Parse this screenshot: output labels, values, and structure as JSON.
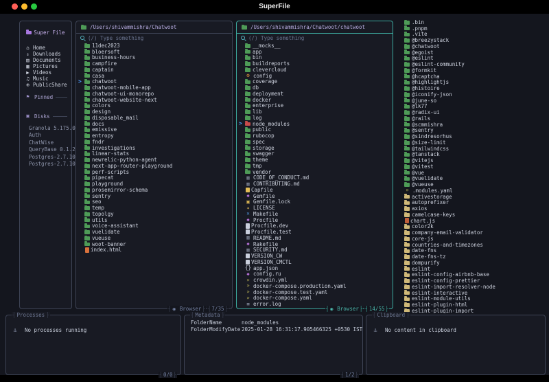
{
  "window": {
    "title": "SuperFile"
  },
  "colors": {
    "bg_app": "#14161e",
    "bg_panel": "#181a23",
    "accent": "#3caa9f",
    "border": "#3e4456",
    "cursor_blue": "#4d9fff",
    "folder_green": "#4e9b57",
    "npm_red": "#c84b4b",
    "pkg_tan": "#cfb878",
    "path": "#b6abdf"
  },
  "sidebar": {
    "title": "Super File",
    "title_icon": "folder-app",
    "items": [
      {
        "icon": "home",
        "label": "Home"
      },
      {
        "icon": "downloads",
        "label": "Downloads"
      },
      {
        "icon": "documents",
        "label": "Documents"
      },
      {
        "icon": "pictures",
        "label": "Pictures"
      },
      {
        "icon": "videos",
        "label": "Videos"
      },
      {
        "icon": "music",
        "label": "Music"
      },
      {
        "icon": "publicshare",
        "label": "PublicShare"
      }
    ],
    "sections": [
      {
        "label": "Pinned",
        "icon": "pin",
        "items": []
      },
      {
        "label": "Disks",
        "icon": "disk",
        "items": [
          "Granola 5.175.0...",
          "Auth",
          "ChatWise",
          "QueryBase 0.1.2...",
          "Postgres-2.7.10...",
          "Postgres-2.7.10..."
        ]
      }
    ]
  },
  "panels": [
    {
      "path": "/Users/shivammishra/Chatwoot",
      "search_placeholder": "(/) Type something",
      "mode_label": "Browser",
      "counter": "7/35",
      "active": false,
      "files": [
        {
          "icon": "folder",
          "label": "11dec2023"
        },
        {
          "icon": "folder",
          "label": "bloersoft"
        },
        {
          "icon": "folder",
          "label": "business-hours"
        },
        {
          "icon": "folder",
          "label": "campfire"
        },
        {
          "icon": "folder",
          "label": "captain"
        },
        {
          "icon": "folder",
          "label": "casa"
        },
        {
          "icon": "folder",
          "label": "chatwoot",
          "selected": true
        },
        {
          "icon": "folder",
          "label": "chatwoot-mobile-app"
        },
        {
          "icon": "folder",
          "label": "chatwoot-ui-monorepo"
        },
        {
          "icon": "folder",
          "label": "chatwoot-website-next"
        },
        {
          "icon": "folder",
          "label": "colors"
        },
        {
          "icon": "folder",
          "label": "design"
        },
        {
          "icon": "folder",
          "label": "disposable_mail"
        },
        {
          "icon": "folder",
          "label": "docs"
        },
        {
          "icon": "folder",
          "label": "emissive"
        },
        {
          "icon": "folder",
          "label": "entropy"
        },
        {
          "icon": "folder",
          "label": "fndr"
        },
        {
          "icon": "folder",
          "label": "investigations"
        },
        {
          "icon": "folder",
          "label": "linear-stats"
        },
        {
          "icon": "folder",
          "label": "newrelic-python-agent"
        },
        {
          "icon": "folder",
          "label": "next-app-router-playground"
        },
        {
          "icon": "folder",
          "label": "perf-scripts"
        },
        {
          "icon": "folder",
          "label": "pipecat"
        },
        {
          "icon": "folder",
          "label": "playground"
        },
        {
          "icon": "folder",
          "label": "prosemirror-schema"
        },
        {
          "icon": "folder",
          "label": "sentry"
        },
        {
          "icon": "folder",
          "label": "seo"
        },
        {
          "icon": "folder",
          "label": "temp"
        },
        {
          "icon": "folder",
          "label": "topolgy"
        },
        {
          "icon": "folder",
          "label": "utils"
        },
        {
          "icon": "folder",
          "label": "voice-assistant"
        },
        {
          "icon": "folder",
          "label": "vuelidate"
        },
        {
          "icon": "folder",
          "label": "vueuse"
        },
        {
          "icon": "folder",
          "label": "woot-banner"
        },
        {
          "icon": "html",
          "label": "index.html"
        }
      ]
    },
    {
      "path": "/Users/shivammishra/Chatwoot/chatwoot",
      "search_placeholder": "(/) Type something",
      "mode_label": "Browser",
      "counter": "14/55",
      "active": true,
      "files": [
        {
          "icon": "folder",
          "label": "__mocks__"
        },
        {
          "icon": "folder",
          "label": "app"
        },
        {
          "icon": "folder",
          "label": "bin"
        },
        {
          "icon": "folder",
          "label": "buildreports"
        },
        {
          "icon": "folder",
          "label": "clevercloud"
        },
        {
          "icon": "gear",
          "label": "config"
        },
        {
          "icon": "folder",
          "label": "coverage"
        },
        {
          "icon": "folder",
          "label": "db"
        },
        {
          "icon": "folder",
          "label": "deployment"
        },
        {
          "icon": "folder",
          "label": "docker"
        },
        {
          "icon": "folder",
          "label": "enterprise"
        },
        {
          "icon": "folder",
          "label": "lib"
        },
        {
          "icon": "folder",
          "label": "log"
        },
        {
          "icon": "folder-npm",
          "label": "node_modules",
          "selected": true
        },
        {
          "icon": "folder",
          "label": "public"
        },
        {
          "icon": "folder",
          "label": "rubocop"
        },
        {
          "icon": "folder",
          "label": "spec"
        },
        {
          "icon": "folder",
          "label": "storage"
        },
        {
          "icon": "folder",
          "label": "swagger"
        },
        {
          "icon": "folder",
          "label": "theme"
        },
        {
          "icon": "folder",
          "label": "tmp"
        },
        {
          "icon": "folder",
          "label": "vendor"
        },
        {
          "icon": "markdown",
          "label": "CODE_OF_CONDUCT.md"
        },
        {
          "icon": "markdown",
          "label": "CONTRIBUTING.md"
        },
        {
          "icon": "file-yellow",
          "label": "Capfile"
        },
        {
          "icon": "gem",
          "label": "Gemfile"
        },
        {
          "icon": "lock",
          "label": "Gemfile.lock"
        },
        {
          "icon": "key",
          "label": "LICENSE"
        },
        {
          "icon": "makefile",
          "label": "Makefile"
        },
        {
          "icon": "gem",
          "label": "Procfile"
        },
        {
          "icon": "file",
          "label": "Procfile.dev"
        },
        {
          "icon": "file",
          "label": "Procfile.test"
        },
        {
          "icon": "markdown",
          "label": "README.md"
        },
        {
          "icon": "gem",
          "label": "Rakefile"
        },
        {
          "icon": "markdown",
          "label": "SECURITY.md"
        },
        {
          "icon": "file",
          "label": "VERSION_CW"
        },
        {
          "icon": "file",
          "label": "VERSION_CMCTL"
        },
        {
          "icon": "json",
          "label": "app.json"
        },
        {
          "icon": "gem",
          "label": "config.ru"
        },
        {
          "icon": "yaml",
          "label": "crowdin.yml"
        },
        {
          "icon": "yaml",
          "label": "docker-compose.production.yaml"
        },
        {
          "icon": "yaml",
          "label": "docker-compose.test.yaml"
        },
        {
          "icon": "yaml",
          "label": "docker-compose.yaml"
        },
        {
          "icon": "log",
          "label": "error.log"
        }
      ]
    }
  ],
  "preview": {
    "files": [
      {
        "icon": "folder",
        "label": ".bin"
      },
      {
        "icon": "folder",
        "label": ".pnpm"
      },
      {
        "icon": "folder",
        "label": ".vite"
      },
      {
        "icon": "folder",
        "label": "@breezystack"
      },
      {
        "icon": "folder",
        "label": "@chatwoot"
      },
      {
        "icon": "folder",
        "label": "@egoist"
      },
      {
        "icon": "folder",
        "label": "@eslint"
      },
      {
        "icon": "folder",
        "label": "@eslint-community"
      },
      {
        "icon": "folder",
        "label": "@formkit"
      },
      {
        "icon": "folder",
        "label": "@hcaptcha"
      },
      {
        "icon": "folder",
        "label": "@highlightjs"
      },
      {
        "icon": "folder",
        "label": "@histoire"
      },
      {
        "icon": "folder",
        "label": "@iconify-json"
      },
      {
        "icon": "folder",
        "label": "@june-so"
      },
      {
        "icon": "folder",
        "label": "@lk77"
      },
      {
        "icon": "folder",
        "label": "@radix-ui"
      },
      {
        "icon": "folder",
        "label": "@rails"
      },
      {
        "icon": "folder",
        "label": "@scmmishra"
      },
      {
        "icon": "folder",
        "label": "@sentry"
      },
      {
        "icon": "folder",
        "label": "@sindresorhus"
      },
      {
        "icon": "folder",
        "label": "@size-limit"
      },
      {
        "icon": "folder",
        "label": "@tailwindcss"
      },
      {
        "icon": "folder",
        "label": "@tanstack"
      },
      {
        "icon": "folder",
        "label": "@vitejs"
      },
      {
        "icon": "folder",
        "label": "@vitest"
      },
      {
        "icon": "folder",
        "label": "@vue"
      },
      {
        "icon": "folder",
        "label": "@vuelidate"
      },
      {
        "icon": "folder",
        "label": "@vueuse"
      },
      {
        "icon": "yaml",
        "label": ".modules.yaml"
      },
      {
        "icon": "folder-package",
        "label": "activestorage"
      },
      {
        "icon": "folder-package",
        "label": "autoprefixer"
      },
      {
        "icon": "folder-package",
        "label": "axios"
      },
      {
        "icon": "folder-package",
        "label": "camelcase-keys"
      },
      {
        "icon": "chart",
        "label": "chart.js"
      },
      {
        "icon": "folder-package",
        "label": "color2k"
      },
      {
        "icon": "folder-package",
        "label": "company-email-validator"
      },
      {
        "icon": "folder-package",
        "label": "core-js"
      },
      {
        "icon": "folder-package",
        "label": "countries-and-timezones"
      },
      {
        "icon": "folder-package",
        "label": "date-fns"
      },
      {
        "icon": "folder-package",
        "label": "date-fns-tz"
      },
      {
        "icon": "folder-package",
        "label": "dompurify"
      },
      {
        "icon": "folder-package",
        "label": "eslint"
      },
      {
        "icon": "folder-package",
        "label": "eslint-config-airbnb-base"
      },
      {
        "icon": "folder-package",
        "label": "eslint-config-prettier"
      },
      {
        "icon": "folder-package",
        "label": "eslint-import-resolver-node"
      },
      {
        "icon": "folder-package",
        "label": "eslint-interactive"
      },
      {
        "icon": "folder-package",
        "label": "eslint-module-utils"
      },
      {
        "icon": "folder-package",
        "label": "eslint-plugin-html"
      },
      {
        "icon": "folder-package",
        "label": "eslint-plugin-import"
      }
    ]
  },
  "processes": {
    "title": "Processes",
    "empty_text": "No processes running",
    "counter": "0/0"
  },
  "metadata": {
    "title": "Metadata",
    "counter": "1/2",
    "rows": [
      [
        "FolderName",
        "node_modules"
      ],
      [
        "FolderModifyDate",
        "2025-01-28 16:31:17.905466325 +0530 IST"
      ]
    ]
  },
  "clipboard": {
    "title": "Clipboard",
    "empty_text": "No content in clipboard"
  }
}
